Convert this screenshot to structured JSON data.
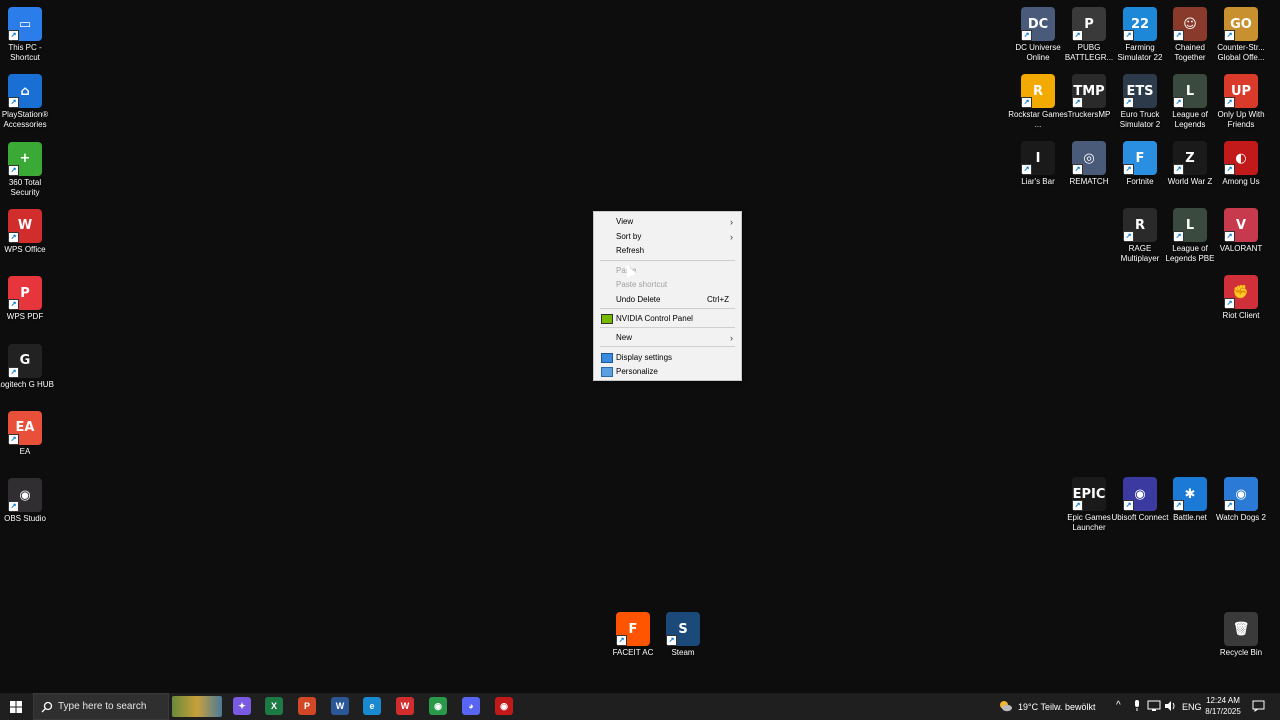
{
  "desktop_icons_left": [
    {
      "label": "This PC - Shortcut",
      "icon": "monitor-icon",
      "color": "#2b7de9",
      "glyph": "▭"
    },
    {
      "label": "PlayStation® Accessories",
      "icon": "gamepad-icon",
      "color": "#1a6fd4",
      "glyph": "⌂"
    },
    {
      "label": "360 Total Security",
      "icon": "shield-plus-icon",
      "color": "#3ba935",
      "glyph": "+"
    },
    {
      "label": "WPS Office",
      "icon": "wps-icon",
      "color": "#d12d2d",
      "glyph": "W"
    },
    {
      "label": "WPS PDF",
      "icon": "pdf-icon",
      "color": "#e6353d",
      "glyph": "P"
    },
    {
      "label": "Logitech G HUB",
      "icon": "logitech-icon",
      "color": "#222222",
      "glyph": "G"
    },
    {
      "label": "EA",
      "icon": "ea-icon",
      "color": "#e8503a",
      "glyph": "EA"
    },
    {
      "label": "OBS Studio",
      "icon": "obs-icon",
      "color": "#302e31",
      "glyph": "◉"
    }
  ],
  "desktop_icons_right": [
    {
      "label": "DC Universe Online",
      "icon": "dcuo-icon",
      "color": "#4a5a7a",
      "glyph": "DC"
    },
    {
      "label": "PUBG BATTLEGR...",
      "icon": "pubg-icon",
      "color": "#3a3a3a",
      "glyph": "P"
    },
    {
      "label": "Farming Simulator 22",
      "icon": "farming-icon",
      "color": "#1e88d8",
      "glyph": "22"
    },
    {
      "label": "Chained Together",
      "icon": "chained-icon",
      "color": "#8a3a2a",
      "glyph": "☺"
    },
    {
      "label": "Counter-Str... Global Offe...",
      "icon": "csgo-icon",
      "color": "#c9902f",
      "glyph": "GO"
    },
    {
      "label": "Rockstar Games ...",
      "icon": "rockstar-icon",
      "color": "#f2a900",
      "glyph": "R"
    },
    {
      "label": "TruckersMP",
      "icon": "truckersmp-icon",
      "color": "#2a2a2a",
      "glyph": "TMP"
    },
    {
      "label": "Euro Truck Simulator 2",
      "icon": "ets2-icon",
      "color": "#2d3a4a",
      "glyph": "ETS"
    },
    {
      "label": "League of Legends",
      "icon": "lol-icon",
      "color": "#3b4a3f",
      "glyph": "L"
    },
    {
      "label": "Only Up With Friends",
      "icon": "onlyup-icon",
      "color": "#d93a2a",
      "glyph": "UP"
    },
    {
      "label": "Liar's Bar",
      "icon": "liarsbar-icon",
      "color": "#1a1a1a",
      "glyph": "I"
    },
    {
      "label": "REMATCH",
      "icon": "rematch-icon",
      "color": "#4a5b7a",
      "glyph": "◎"
    },
    {
      "label": "Fortnite",
      "icon": "fortnite-icon",
      "color": "#2a8fe0",
      "glyph": "F"
    },
    {
      "label": "World War Z",
      "icon": "wwz-icon",
      "color": "#1a1a1a",
      "glyph": "Z"
    },
    {
      "label": "Among Us",
      "icon": "amongus-icon",
      "color": "#c21a1a",
      "glyph": "◐"
    },
    {
      "label": "RAGE Multiplayer",
      "icon": "ragemp-icon",
      "color": "#2a2a2a",
      "glyph": "R"
    },
    {
      "label": "League of Legends PBE",
      "icon": "lolpbe-icon",
      "color": "#3b4a3f",
      "glyph": "L"
    },
    {
      "label": "VALORANT",
      "icon": "valorant-icon",
      "color": "#c73a4e",
      "glyph": "V"
    },
    {
      "label": "Riot Client",
      "icon": "riot-icon",
      "color": "#d1303a",
      "glyph": "✊"
    },
    {
      "label": "Epic Games Launcher",
      "icon": "epic-icon",
      "color": "#1a1a1a",
      "glyph": "EPIC"
    },
    {
      "label": "Ubisoft Connect",
      "icon": "ubisoft-icon",
      "color": "#3a3aa0",
      "glyph": "◉"
    },
    {
      "label": "Battle.net",
      "icon": "battlenet-icon",
      "color": "#1b7ad6",
      "glyph": "✱"
    },
    {
      "label": "Watch Dogs 2",
      "icon": "watchdogs-icon",
      "color": "#2a7ad6",
      "glyph": "◉"
    },
    {
      "label": "Recycle Bin",
      "icon": "recycle-bin-icon",
      "color": "#3a3a3a",
      "glyph": "🗑"
    }
  ],
  "desktop_icons_bottom": [
    {
      "label": "FACEIT AC",
      "icon": "faceit-icon",
      "color": "#ff5500",
      "glyph": "F"
    },
    {
      "label": "Steam",
      "icon": "steam-icon",
      "color": "#1b4a7a",
      "glyph": "S"
    }
  ],
  "context_menu": {
    "view": "View",
    "sort_by": "Sort by",
    "refresh": "Refresh",
    "paste": "Paste",
    "paste_shortcut": "Paste shortcut",
    "undo_delete": "Undo Delete",
    "undo_shortcut": "Ctrl+Z",
    "nvidia": "NVIDIA Control Panel",
    "new": "New",
    "display_settings": "Display settings",
    "personalize": "Personalize"
  },
  "taskbar": {
    "search_placeholder": "Type here to search",
    "apps": [
      {
        "name": "copilot-icon",
        "color": "#7a5ae0",
        "glyph": "✦"
      },
      {
        "name": "excel-icon",
        "color": "#1d7a44",
        "glyph": "X"
      },
      {
        "name": "powerpoint-icon",
        "color": "#d24726",
        "glyph": "P"
      },
      {
        "name": "word-icon",
        "color": "#2b5797",
        "glyph": "W"
      },
      {
        "name": "edge-icon",
        "color": "#1a8ad0",
        "glyph": "e"
      },
      {
        "name": "wps-taskbar-icon",
        "color": "#d12d2d",
        "glyph": "W"
      },
      {
        "name": "chrome-icon",
        "color": "#2a9a4a",
        "glyph": "◉"
      },
      {
        "name": "discord-icon",
        "color": "#5865f2",
        "glyph": "◕"
      },
      {
        "name": "app-icon",
        "color": "#c21a1a",
        "glyph": "◉"
      }
    ],
    "weather": "19°C  Teilw. bewölkt",
    "language": "ENG",
    "time": "12:24 AM",
    "date": "8/17/2025"
  }
}
